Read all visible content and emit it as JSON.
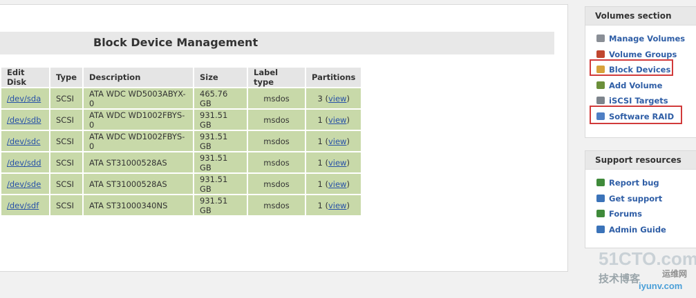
{
  "page_title": "Block Device Management",
  "table": {
    "headers": [
      "Edit Disk",
      "Type",
      "Description",
      "Size",
      "Label type",
      "Partitions"
    ],
    "rows": [
      {
        "disk": "/dev/sda",
        "type": "SCSI",
        "description": "ATA WDC WD5003ABYX-0",
        "size": "465.76 GB",
        "label": "msdos",
        "partitions": "3",
        "view": "view"
      },
      {
        "disk": "/dev/sdb",
        "type": "SCSI",
        "description": "ATA WDC WD1002FBYS-0",
        "size": "931.51 GB",
        "label": "msdos",
        "partitions": "1",
        "view": "view"
      },
      {
        "disk": "/dev/sdc",
        "type": "SCSI",
        "description": "ATA WDC WD1002FBYS-0",
        "size": "931.51 GB",
        "label": "msdos",
        "partitions": "1",
        "view": "view"
      },
      {
        "disk": "/dev/sdd",
        "type": "SCSI",
        "description": "ATA ST31000528AS",
        "size": "931.51 GB",
        "label": "msdos",
        "partitions": "1",
        "view": "view"
      },
      {
        "disk": "/dev/sde",
        "type": "SCSI",
        "description": "ATA ST31000528AS",
        "size": "931.51 GB",
        "label": "msdos",
        "partitions": "1",
        "view": "view"
      },
      {
        "disk": "/dev/sdf",
        "type": "SCSI",
        "description": "ATA ST31000340NS",
        "size": "931.51 GB",
        "label": "msdos",
        "partitions": "1",
        "view": "view"
      }
    ]
  },
  "volumes_section": {
    "title": "Volumes section",
    "items": [
      {
        "label": "Manage Volumes",
        "icon": "disk-icon",
        "color": "#8a8f96"
      },
      {
        "label": "Volume Groups",
        "icon": "volume-groups-icon",
        "color": "#c0462f"
      },
      {
        "label": "Block Devices",
        "icon": "block-devices-icon",
        "color": "#d7a23b"
      },
      {
        "label": "Add Volume",
        "icon": "add-volume-icon",
        "color": "#6b8f3a"
      },
      {
        "label": "iSCSI Targets",
        "icon": "iscsi-icon",
        "color": "#7d848c"
      },
      {
        "label": "Software RAID",
        "icon": "raid-icon",
        "color": "#4f7fc4"
      }
    ]
  },
  "support_resources": {
    "title": "Support resources",
    "items": [
      {
        "label": "Report bug",
        "icon": "bug-icon",
        "color": "#3f8a3a"
      },
      {
        "label": "Get support",
        "icon": "support-icon",
        "color": "#3b73b9"
      },
      {
        "label": "Forums",
        "icon": "forums-icon",
        "color": "#3f8a3a"
      },
      {
        "label": "Admin Guide",
        "icon": "guide-icon",
        "color": "#3b73b9"
      }
    ]
  },
  "watermark": {
    "site": "51CTO.com",
    "cn": "技术博客",
    "tag": "运维网",
    "url": "iyunv.com"
  },
  "colors": {
    "row_bg": "#c8d9a9",
    "header_bg": "#e5e5e5",
    "link": "#2650a8",
    "highlight_border": "#d13a3a"
  }
}
